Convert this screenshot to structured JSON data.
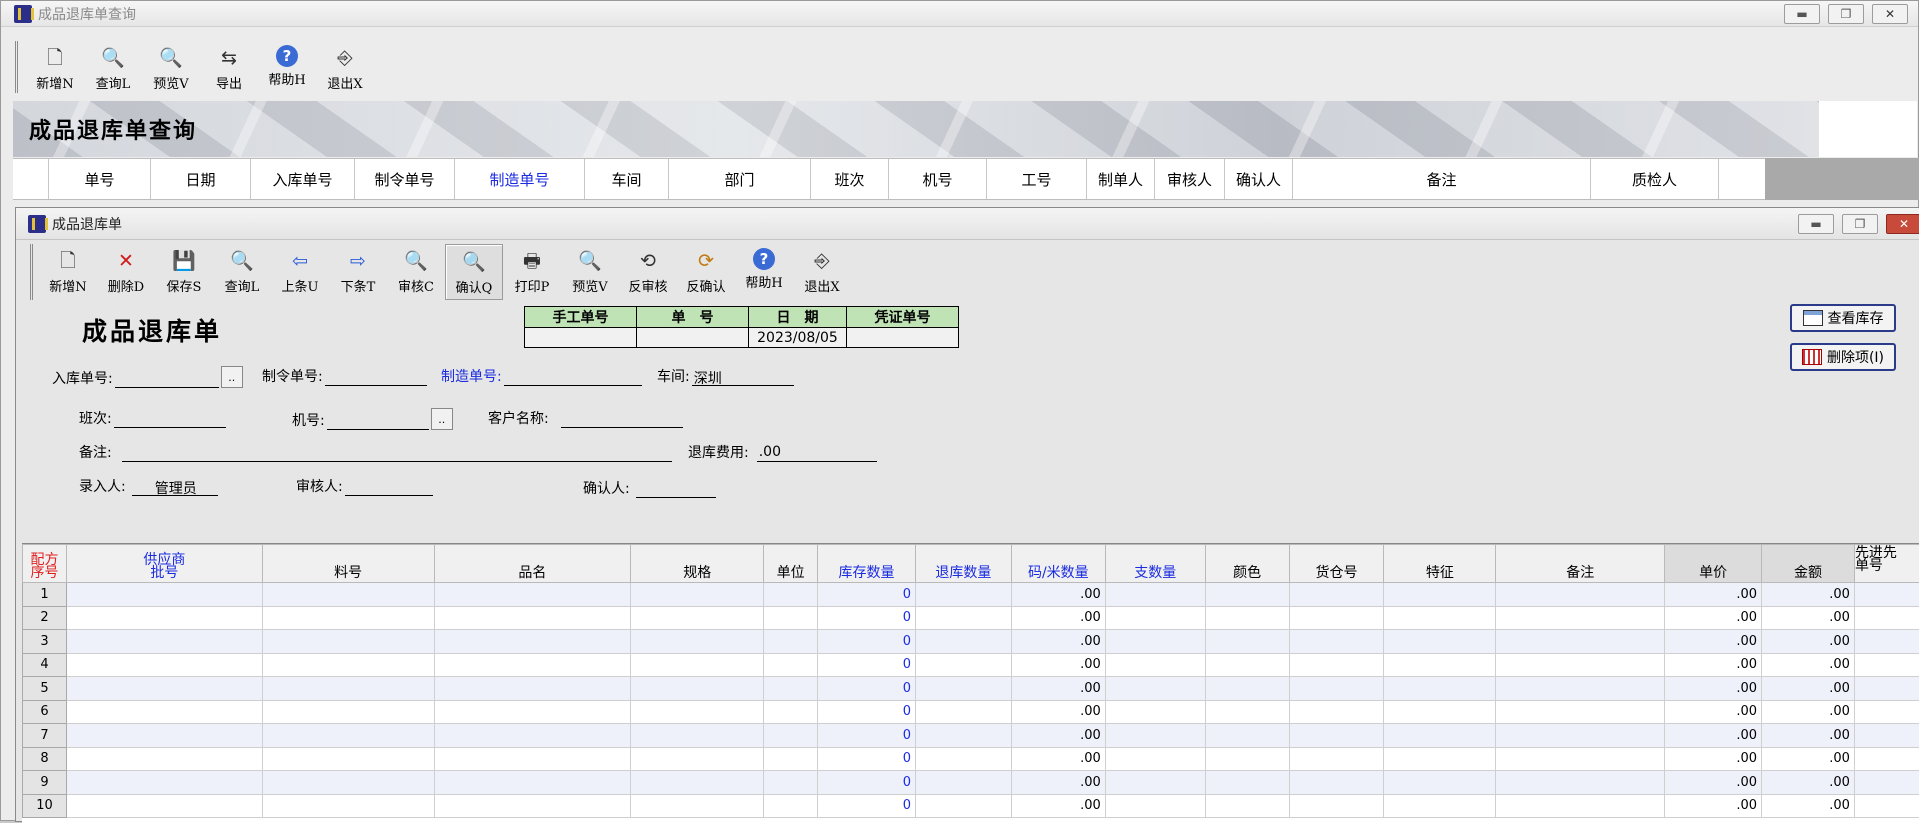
{
  "outer": {
    "title": "成品退库单查询",
    "toolbar": [
      {
        "label": "新增N",
        "icon": "new-doc-icon"
      },
      {
        "label": "查询L",
        "icon": "query-icon"
      },
      {
        "label": "预览V",
        "icon": "preview-icon"
      },
      {
        "label": "导出",
        "icon": "export-icon"
      },
      {
        "label": "帮助H",
        "icon": "help-icon"
      },
      {
        "label": "退出X",
        "icon": "exit-icon"
      }
    ],
    "banner_title": "成品退库单查询",
    "grid_headers": [
      "",
      "单号",
      "日期",
      "入库单号",
      "制令单号",
      "制造单号",
      "车间",
      "部门",
      "班次",
      "机号",
      "工号",
      "制单人",
      "审核人",
      "确认人",
      "备注",
      "质检人"
    ]
  },
  "inner": {
    "title": "成品退库单",
    "toolbar": [
      {
        "label": "新增N",
        "icon": "new-doc-icon"
      },
      {
        "label": "删除D",
        "icon": "delete-icon"
      },
      {
        "label": "保存S",
        "icon": "save-icon"
      },
      {
        "label": "查询L",
        "icon": "query-icon"
      },
      {
        "label": "上条U",
        "icon": "prev-arrow-icon"
      },
      {
        "label": "下条T",
        "icon": "next-arrow-icon"
      },
      {
        "label": "审核C",
        "icon": "audit-icon"
      },
      {
        "label": "确认Q",
        "icon": "confirm-icon"
      },
      {
        "label": "打印P",
        "icon": "print-icon"
      },
      {
        "label": "预览V",
        "icon": "preview-icon"
      },
      {
        "label": "反审核",
        "icon": "unaudit-icon"
      },
      {
        "label": "反确认",
        "icon": "unconfirm-icon"
      },
      {
        "label": "帮助H",
        "icon": "help-icon"
      },
      {
        "label": "退出X",
        "icon": "exit-icon"
      }
    ],
    "form_title": "成品退库单",
    "doc_table": {
      "headers": [
        "手工单号",
        "单　号",
        "日　期",
        "凭证单号"
      ],
      "values": [
        "",
        "",
        "2023/08/05",
        ""
      ]
    },
    "side_buttons": {
      "view_stock": "查看库存",
      "delete_item": "删除项(I)"
    },
    "fields": {
      "in_no_label": "入库单号:",
      "in_no": "",
      "order_no_label": "制令单号:",
      "order_no": "",
      "mfg_no_label": "制造单号:",
      "mfg_no": "",
      "workshop_label": "车间:",
      "workshop": "深圳",
      "shift_label": "班次:",
      "shift": "",
      "machine_label": "机号:",
      "machine": "",
      "customer_label": "客户名称:",
      "customer": "",
      "remark_label": "备注:",
      "remark": "",
      "fee_label": "退库费用:",
      "fee": ".00",
      "entry_label": "录入人:",
      "entry": "管理员",
      "auditor_label": "审核人:",
      "auditor": "",
      "confirmer_label": "确认人:",
      "confirmer": ""
    },
    "grid": {
      "headers": [
        {
          "text": "配方\n序号",
          "style": "red"
        },
        {
          "text": "供应商\n批号",
          "style": "blue"
        },
        {
          "text": "料号",
          "style": ""
        },
        {
          "text": "品名",
          "style": ""
        },
        {
          "text": "规格",
          "style": ""
        },
        {
          "text": "单位",
          "style": ""
        },
        {
          "text": "库存数量",
          "style": "blue"
        },
        {
          "text": "退库数量",
          "style": "blue"
        },
        {
          "text": "码/米数量",
          "style": "blue"
        },
        {
          "text": "支数量",
          "style": "blue"
        },
        {
          "text": "颜色",
          "style": ""
        },
        {
          "text": "货仓号",
          "style": ""
        },
        {
          "text": "特征",
          "style": ""
        },
        {
          "text": "备注",
          "style": ""
        },
        {
          "text": "单价",
          "style": "dk"
        },
        {
          "text": "金额",
          "style": "dk"
        },
        {
          "text": "先进先\n单号",
          "style": ""
        }
      ],
      "rows": [
        {
          "no": "1",
          "stock": "0",
          "yard": ".00",
          "price": ".00",
          "amount": ".00"
        },
        {
          "no": "2",
          "stock": "0",
          "yard": ".00",
          "price": ".00",
          "amount": ".00"
        },
        {
          "no": "3",
          "stock": "0",
          "yard": ".00",
          "price": ".00",
          "amount": ".00"
        },
        {
          "no": "4",
          "stock": "0",
          "yard": ".00",
          "price": ".00",
          "amount": ".00"
        },
        {
          "no": "5",
          "stock": "0",
          "yard": ".00",
          "price": ".00",
          "amount": ".00"
        },
        {
          "no": "6",
          "stock": "0",
          "yard": ".00",
          "price": ".00",
          "amount": ".00"
        },
        {
          "no": "7",
          "stock": "0",
          "yard": ".00",
          "price": ".00",
          "amount": ".00"
        },
        {
          "no": "8",
          "stock": "0",
          "yard": ".00",
          "price": ".00",
          "amount": ".00"
        },
        {
          "no": "9",
          "stock": "0",
          "yard": ".00",
          "price": ".00",
          "amount": ".00"
        },
        {
          "no": "10",
          "stock": "0",
          "yard": ".00",
          "price": ".00",
          "amount": ".00"
        }
      ]
    }
  }
}
